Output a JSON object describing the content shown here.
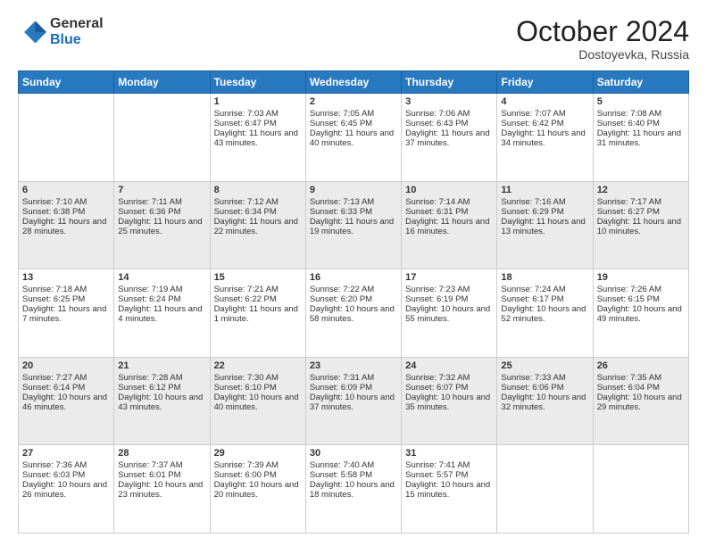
{
  "header": {
    "logo_general": "General",
    "logo_blue": "Blue",
    "month_title": "October 2024",
    "location": "Dostoyevka, Russia"
  },
  "days_of_week": [
    "Sunday",
    "Monday",
    "Tuesday",
    "Wednesday",
    "Thursday",
    "Friday",
    "Saturday"
  ],
  "weeks": [
    [
      {
        "day": "",
        "sunrise": "",
        "sunset": "",
        "daylight": ""
      },
      {
        "day": "",
        "sunrise": "",
        "sunset": "",
        "daylight": ""
      },
      {
        "day": "1",
        "sunrise": "Sunrise: 7:03 AM",
        "sunset": "Sunset: 6:47 PM",
        "daylight": "Daylight: 11 hours and 43 minutes."
      },
      {
        "day": "2",
        "sunrise": "Sunrise: 7:05 AM",
        "sunset": "Sunset: 6:45 PM",
        "daylight": "Daylight: 11 hours and 40 minutes."
      },
      {
        "day": "3",
        "sunrise": "Sunrise: 7:06 AM",
        "sunset": "Sunset: 6:43 PM",
        "daylight": "Daylight: 11 hours and 37 minutes."
      },
      {
        "day": "4",
        "sunrise": "Sunrise: 7:07 AM",
        "sunset": "Sunset: 6:42 PM",
        "daylight": "Daylight: 11 hours and 34 minutes."
      },
      {
        "day": "5",
        "sunrise": "Sunrise: 7:08 AM",
        "sunset": "Sunset: 6:40 PM",
        "daylight": "Daylight: 11 hours and 31 minutes."
      }
    ],
    [
      {
        "day": "6",
        "sunrise": "Sunrise: 7:10 AM",
        "sunset": "Sunset: 6:38 PM",
        "daylight": "Daylight: 11 hours and 28 minutes."
      },
      {
        "day": "7",
        "sunrise": "Sunrise: 7:11 AM",
        "sunset": "Sunset: 6:36 PM",
        "daylight": "Daylight: 11 hours and 25 minutes."
      },
      {
        "day": "8",
        "sunrise": "Sunrise: 7:12 AM",
        "sunset": "Sunset: 6:34 PM",
        "daylight": "Daylight: 11 hours and 22 minutes."
      },
      {
        "day": "9",
        "sunrise": "Sunrise: 7:13 AM",
        "sunset": "Sunset: 6:33 PM",
        "daylight": "Daylight: 11 hours and 19 minutes."
      },
      {
        "day": "10",
        "sunrise": "Sunrise: 7:14 AM",
        "sunset": "Sunset: 6:31 PM",
        "daylight": "Daylight: 11 hours and 16 minutes."
      },
      {
        "day": "11",
        "sunrise": "Sunrise: 7:16 AM",
        "sunset": "Sunset: 6:29 PM",
        "daylight": "Daylight: 11 hours and 13 minutes."
      },
      {
        "day": "12",
        "sunrise": "Sunrise: 7:17 AM",
        "sunset": "Sunset: 6:27 PM",
        "daylight": "Daylight: 11 hours and 10 minutes."
      }
    ],
    [
      {
        "day": "13",
        "sunrise": "Sunrise: 7:18 AM",
        "sunset": "Sunset: 6:25 PM",
        "daylight": "Daylight: 11 hours and 7 minutes."
      },
      {
        "day": "14",
        "sunrise": "Sunrise: 7:19 AM",
        "sunset": "Sunset: 6:24 PM",
        "daylight": "Daylight: 11 hours and 4 minutes."
      },
      {
        "day": "15",
        "sunrise": "Sunrise: 7:21 AM",
        "sunset": "Sunset: 6:22 PM",
        "daylight": "Daylight: 11 hours and 1 minute."
      },
      {
        "day": "16",
        "sunrise": "Sunrise: 7:22 AM",
        "sunset": "Sunset: 6:20 PM",
        "daylight": "Daylight: 10 hours and 58 minutes."
      },
      {
        "day": "17",
        "sunrise": "Sunrise: 7:23 AM",
        "sunset": "Sunset: 6:19 PM",
        "daylight": "Daylight: 10 hours and 55 minutes."
      },
      {
        "day": "18",
        "sunrise": "Sunrise: 7:24 AM",
        "sunset": "Sunset: 6:17 PM",
        "daylight": "Daylight: 10 hours and 52 minutes."
      },
      {
        "day": "19",
        "sunrise": "Sunrise: 7:26 AM",
        "sunset": "Sunset: 6:15 PM",
        "daylight": "Daylight: 10 hours and 49 minutes."
      }
    ],
    [
      {
        "day": "20",
        "sunrise": "Sunrise: 7:27 AM",
        "sunset": "Sunset: 6:14 PM",
        "daylight": "Daylight: 10 hours and 46 minutes."
      },
      {
        "day": "21",
        "sunrise": "Sunrise: 7:28 AM",
        "sunset": "Sunset: 6:12 PM",
        "daylight": "Daylight: 10 hours and 43 minutes."
      },
      {
        "day": "22",
        "sunrise": "Sunrise: 7:30 AM",
        "sunset": "Sunset: 6:10 PM",
        "daylight": "Daylight: 10 hours and 40 minutes."
      },
      {
        "day": "23",
        "sunrise": "Sunrise: 7:31 AM",
        "sunset": "Sunset: 6:09 PM",
        "daylight": "Daylight: 10 hours and 37 minutes."
      },
      {
        "day": "24",
        "sunrise": "Sunrise: 7:32 AM",
        "sunset": "Sunset: 6:07 PM",
        "daylight": "Daylight: 10 hours and 35 minutes."
      },
      {
        "day": "25",
        "sunrise": "Sunrise: 7:33 AM",
        "sunset": "Sunset: 6:06 PM",
        "daylight": "Daylight: 10 hours and 32 minutes."
      },
      {
        "day": "26",
        "sunrise": "Sunrise: 7:35 AM",
        "sunset": "Sunset: 6:04 PM",
        "daylight": "Daylight: 10 hours and 29 minutes."
      }
    ],
    [
      {
        "day": "27",
        "sunrise": "Sunrise: 7:36 AM",
        "sunset": "Sunset: 6:03 PM",
        "daylight": "Daylight: 10 hours and 26 minutes."
      },
      {
        "day": "28",
        "sunrise": "Sunrise: 7:37 AM",
        "sunset": "Sunset: 6:01 PM",
        "daylight": "Daylight: 10 hours and 23 minutes."
      },
      {
        "day": "29",
        "sunrise": "Sunrise: 7:39 AM",
        "sunset": "Sunset: 6:00 PM",
        "daylight": "Daylight: 10 hours and 20 minutes."
      },
      {
        "day": "30",
        "sunrise": "Sunrise: 7:40 AM",
        "sunset": "Sunset: 5:58 PM",
        "daylight": "Daylight: 10 hours and 18 minutes."
      },
      {
        "day": "31",
        "sunrise": "Sunrise: 7:41 AM",
        "sunset": "Sunset: 5:57 PM",
        "daylight": "Daylight: 10 hours and 15 minutes."
      },
      {
        "day": "",
        "sunrise": "",
        "sunset": "",
        "daylight": ""
      },
      {
        "day": "",
        "sunrise": "",
        "sunset": "",
        "daylight": ""
      }
    ]
  ]
}
